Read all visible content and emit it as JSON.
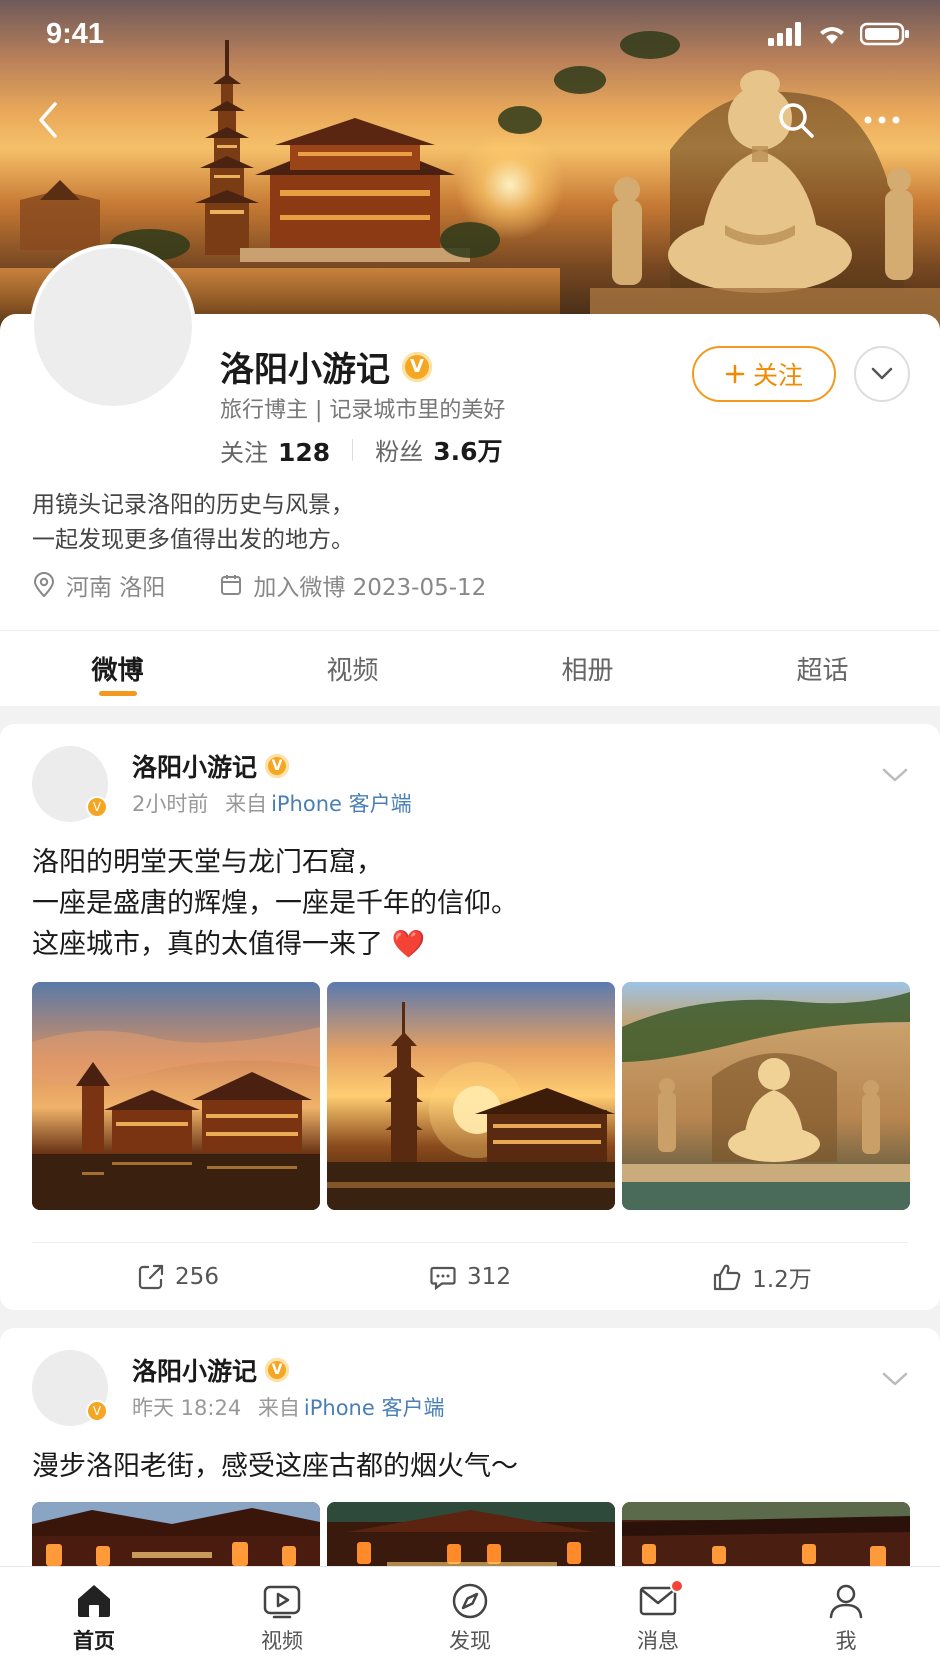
{
  "status_bar": {
    "time": "9:41"
  },
  "profile": {
    "name": "洛阳小游记",
    "description": "旅行博主 | 记录城市里的美好",
    "following_label": "关注",
    "following_count": "128",
    "followers_label": "粉丝",
    "followers_count": "3.6万",
    "follow_button": "关注",
    "bio_line1": "用镜头记录洛阳的历史与风景，",
    "bio_line2": "一起发现更多值得出发的地方。",
    "location": "河南 洛阳",
    "joined": "加入微博 2023-05-12"
  },
  "tabs": [
    {
      "label": "微博",
      "active": true
    },
    {
      "label": "视频",
      "active": false
    },
    {
      "label": "相册",
      "active": false
    },
    {
      "label": "超话",
      "active": false
    }
  ],
  "posts": [
    {
      "author": "洛阳小游记",
      "time": "2小时前",
      "from": "来自",
      "source": "iPhone 客户端",
      "line1": "洛阳的明堂天堂与龙门石窟，",
      "line2": "一座是盛唐的辉煌，一座是千年的信仰。",
      "line3": "这座城市，真的太值得一来了",
      "emoji": "❤️",
      "reposts": "256",
      "comments": "312",
      "likes": "1.2万"
    },
    {
      "author": "洛阳小游记",
      "time": "昨天 18:24",
      "from": "来自",
      "source": "iPhone 客户端",
      "line1": "漫步洛阳老街，感受这座古都的烟火气～"
    }
  ],
  "bottom_nav": [
    {
      "label": "首页",
      "icon": "home-icon",
      "active": true
    },
    {
      "label": "视频",
      "icon": "video-icon",
      "active": false
    },
    {
      "label": "发现",
      "icon": "compass-icon",
      "active": false
    },
    {
      "label": "消息",
      "icon": "mail-icon",
      "active": false,
      "badge": true
    },
    {
      "label": "我",
      "icon": "person-icon",
      "active": false
    }
  ],
  "colors": {
    "accent": "#f39a1e",
    "link": "#4a7fb5",
    "badge_red": "#f5433a"
  }
}
